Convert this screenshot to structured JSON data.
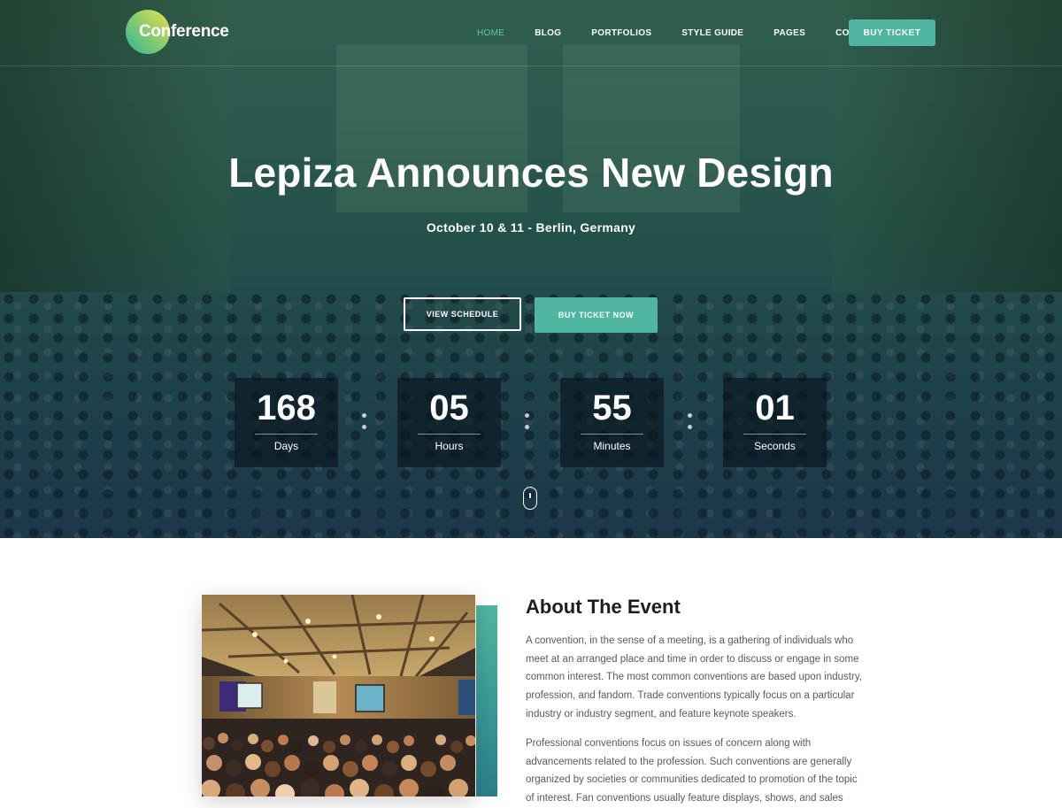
{
  "brand": {
    "logo_text": "Conference"
  },
  "nav": {
    "items": [
      {
        "label": "HOME",
        "active": true
      },
      {
        "label": "BLOG",
        "active": false
      },
      {
        "label": "PORTFOLIOS",
        "active": false
      },
      {
        "label": "STYLE GUIDE",
        "active": false
      },
      {
        "label": "PAGES",
        "active": false
      },
      {
        "label": "CONTACT",
        "active": false
      }
    ],
    "cta_label": "BUY TICKET"
  },
  "hero": {
    "title": "Lepiza Announces New Design",
    "subtitle": "October 10 & 11 - Berlin, Germany",
    "buttons": {
      "schedule": "VIEW SCHEDULE",
      "buy": "BUY TICKET NOW"
    },
    "countdown": [
      {
        "value": "168",
        "label": "Days"
      },
      {
        "value": "05",
        "label": "Hours"
      },
      {
        "value": "55",
        "label": "Minutes"
      },
      {
        "value": "01",
        "label": "Seconds"
      }
    ],
    "scroll_icon": "mouse-scroll-icon"
  },
  "about": {
    "title": "About The Event",
    "paragraphs": [
      "A convention, in the sense of a meeting, is a gathering of individuals who meet at an arranged place and time in order to discuss or engage in some common interest. The most common conventions are based upon industry, profession, and fandom. Trade conventions typically focus on a particular industry or industry segment, and feature keynote speakers.",
      "Professional conventions focus on issues of concern along with advancements related to the profession. Such conventions are generally organized by societies or communities dedicated to promotion of the topic of interest. Fan conventions usually feature displays, shows, and sales"
    ]
  },
  "colors": {
    "accent": "#4fb7a1",
    "hero_overlay": "#23504a",
    "heading": "#1d1d1d",
    "body_text": "#5a5a5a"
  }
}
